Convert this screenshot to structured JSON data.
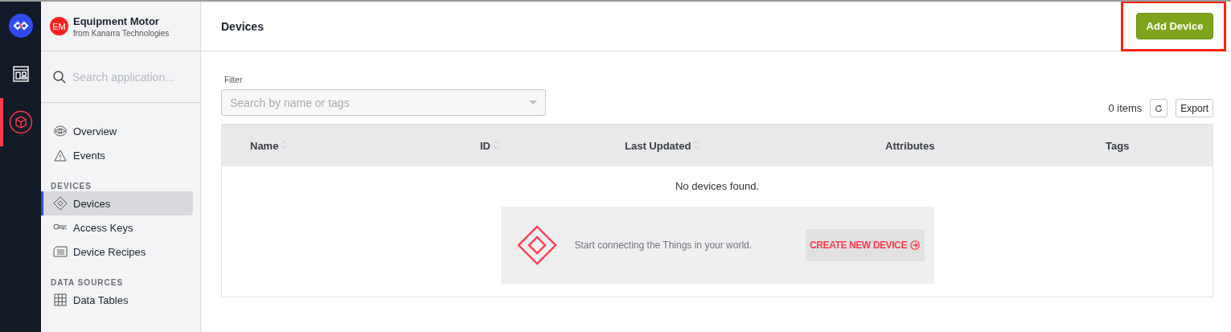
{
  "rail": {
    "items": [
      {
        "kind": "logo",
        "selected": false
      },
      {
        "kind": "dashboard",
        "selected": false
      },
      {
        "kind": "application",
        "selected": true
      }
    ]
  },
  "app": {
    "initials": "EM",
    "name": "Equipment Motor",
    "org": "from Kanarra Technologies"
  },
  "search": {
    "placeholder": "Search application..."
  },
  "nav": [
    {
      "kind": "item",
      "label": "Overview",
      "selected": false
    },
    {
      "kind": "item",
      "label": "Events",
      "selected": false
    },
    {
      "kind": "section",
      "label": "DEVICES"
    },
    {
      "kind": "item",
      "label": "Devices",
      "selected": true
    },
    {
      "kind": "item",
      "label": "Access Keys",
      "selected": false
    },
    {
      "kind": "item",
      "label": "Device Recipes",
      "selected": false
    },
    {
      "kind": "section",
      "label": "DATA SOURCES"
    },
    {
      "kind": "item",
      "label": "Data Tables",
      "selected": false
    }
  ],
  "main": {
    "title": "Devices",
    "add_button": {
      "label": "Add Device",
      "highlighted": true
    },
    "filter": {
      "label": "Filter",
      "placeholder": "Search by name or tags"
    },
    "item_count": "0 items",
    "export_button": "Export",
    "table": {
      "columns": [
        {
          "label": "Name",
          "sortable": true
        },
        {
          "label": "ID",
          "sortable": true
        },
        {
          "label": "Last Updated",
          "sortable": true
        },
        {
          "label": "Attributes",
          "sortable": false
        },
        {
          "label": "Tags",
          "sortable": false
        }
      ],
      "empty_message": "No devices found."
    },
    "promo": {
      "text": "Start connecting the Things in your world.",
      "button": "CREATE NEW DEVICE"
    }
  }
}
